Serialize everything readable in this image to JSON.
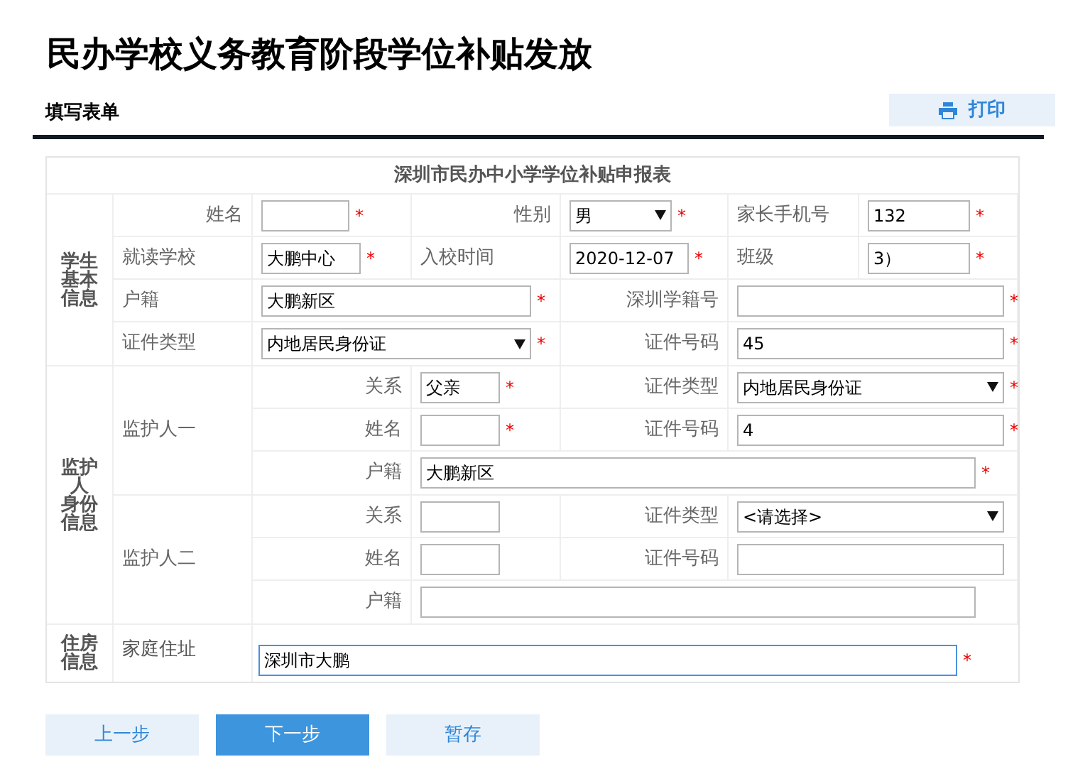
{
  "page_title": "民办学校义务教育阶段学位补贴发放",
  "section_title": "填写表单",
  "print_button": "打印",
  "form_title": "深圳市民办中小学学位补贴申报表",
  "student": {
    "lines": [
      "学生",
      "基本",
      "信息"
    ],
    "fields": [
      {
        "label": "姓名",
        "kind": "text",
        "required_mark": "*"
      },
      {
        "label": "性别",
        "kind": "select",
        "value": "男",
        "required_mark": "*"
      },
      {
        "label": "家长手机号",
        "kind": "text",
        "value": "132",
        "required_mark": "*"
      },
      {
        "label": "就读学校",
        "kind": "text",
        "value": "大鹏中心",
        "required_mark": "*"
      },
      {
        "label": "入校时间",
        "kind": "text",
        "value": "2020-12-07",
        "required_mark": "*"
      },
      {
        "label": "班级",
        "kind": "text",
        "value": "3）",
        "required_mark": "*"
      },
      {
        "label": "户籍",
        "kind": "text",
        "value": "大鹏新区",
        "required_mark": "*"
      },
      {
        "label": "深圳学籍号",
        "kind": "text",
        "required_mark": "*"
      },
      {
        "label": "证件类型",
        "kind": "select",
        "value": "内地居民身份证",
        "required_mark": "*"
      },
      {
        "label": "证件号码",
        "kind": "text",
        "value": "45",
        "required_mark": "*"
      }
    ]
  },
  "guardian_section": {
    "lines": [
      "监护",
      "人",
      "身份",
      "信息"
    ],
    "guardians": [
      {
        "label": "监护人一",
        "fields": [
          {
            "label": "关系",
            "kind": "text",
            "value": "父亲",
            "required_mark": "*"
          },
          {
            "label": "证件类型",
            "kind": "select",
            "value": "内地居民身份证",
            "required_mark": "*"
          },
          {
            "label": "姓名",
            "kind": "text",
            "required_mark": "*"
          },
          {
            "label": "证件号码",
            "kind": "text",
            "value": "4",
            "required_mark": "*"
          },
          {
            "label": "户籍",
            "kind": "text",
            "value": "大鹏新区",
            "required_mark": "*"
          }
        ]
      },
      {
        "label": "监护人二",
        "fields": [
          {
            "label": "关系",
            "kind": "text"
          },
          {
            "label": "证件类型",
            "kind": "select",
            "value": "<请选择>"
          },
          {
            "label": "姓名",
            "kind": "text"
          },
          {
            "label": "证件号码",
            "kind": "text"
          },
          {
            "label": "户籍",
            "kind": "text"
          }
        ]
      }
    ]
  },
  "housing": {
    "lines": [
      "住房",
      "信息"
    ],
    "field": {
      "label": "家庭住址",
      "kind": "text",
      "value": "深圳市大鹏",
      "required_mark": "*",
      "focused": true
    }
  },
  "buttons": [
    {
      "label": "上一步",
      "primary": false
    },
    {
      "label": "下一步",
      "primary": true
    },
    {
      "label": "暂存",
      "primary": false
    }
  ]
}
